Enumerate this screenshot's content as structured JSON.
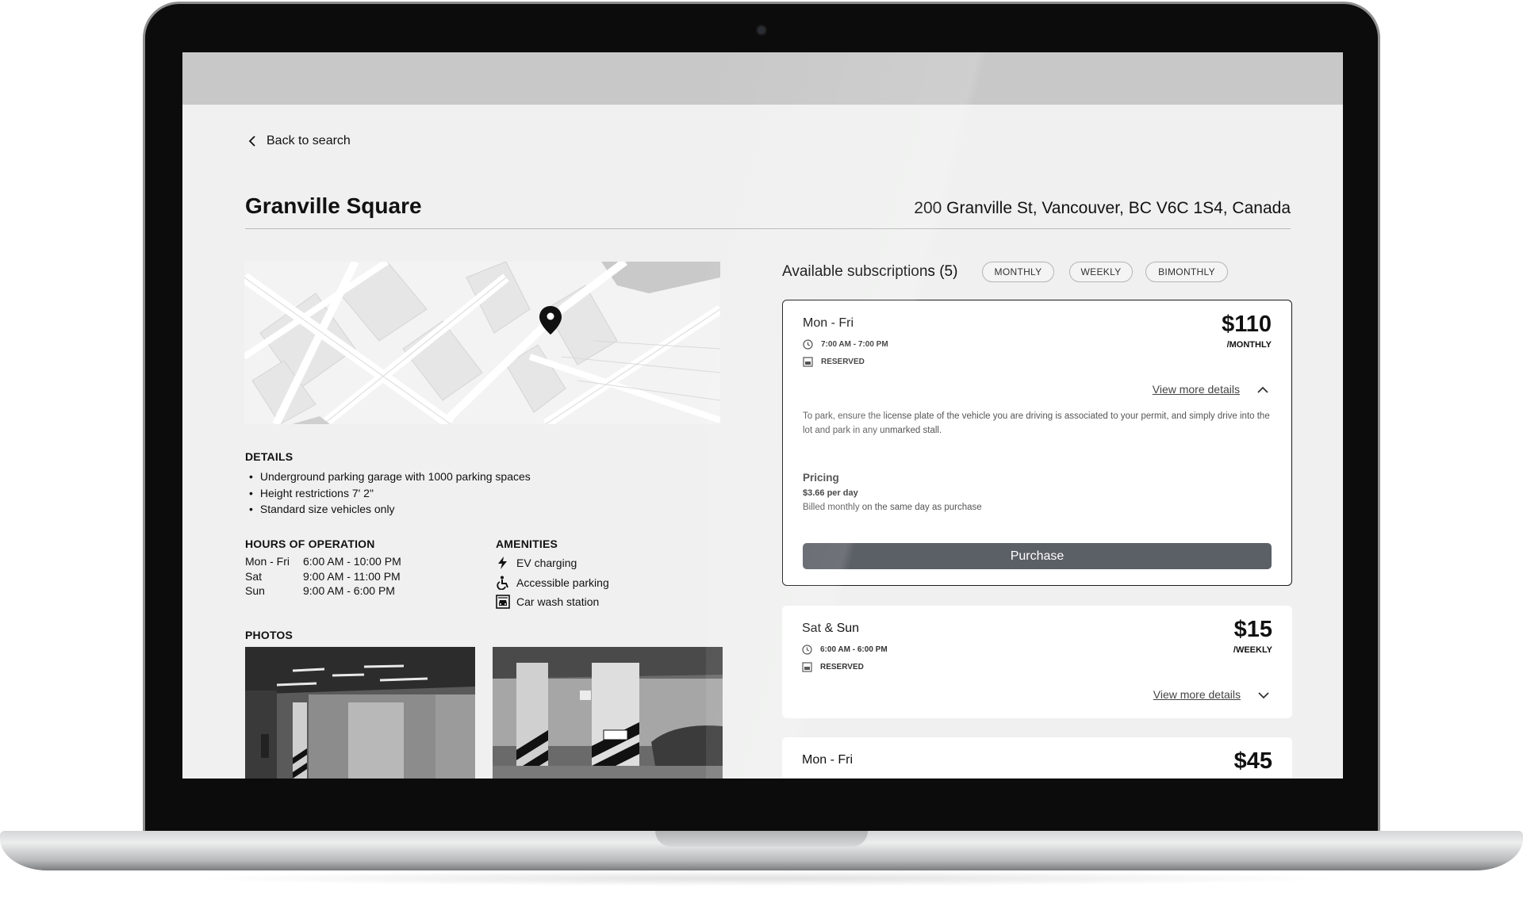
{
  "nav": {
    "back_label": "Back to search"
  },
  "location": {
    "name": "Granville Square",
    "address": "200 Granville St, Vancouver, BC V6C 1S4, Canada"
  },
  "map": {
    "pin_icon": "map-pin-icon"
  },
  "details": {
    "heading": "DETAILS",
    "items": [
      "Underground parking garage with 1000 parking spaces",
      "Height restrictions 7' 2\"",
      "Standard size vehicles only"
    ]
  },
  "hours": {
    "heading": "HOURS OF OPERATION",
    "rows": [
      {
        "day": "Mon - Fri",
        "time": "6:00 AM - 10:00 PM"
      },
      {
        "day": "Sat",
        "time": "9:00 AM - 11:00 PM"
      },
      {
        "day": "Sun",
        "time": "9:00 AM - 6:00 PM"
      }
    ]
  },
  "amenities": {
    "heading": "AMENITIES",
    "items": [
      {
        "icon": "lightning-icon",
        "label": "EV charging"
      },
      {
        "icon": "wheelchair-icon",
        "label": "Accessible parking"
      },
      {
        "icon": "car-wash-icon",
        "label": "Car wash station"
      }
    ]
  },
  "photos": {
    "heading": "PHOTOS"
  },
  "subscriptions": {
    "title": "Available subscriptions (5)",
    "filters": [
      "MONTHLY",
      "WEEKLY",
      "BIMONTHLY"
    ],
    "cards": [
      {
        "days": "Mon - Fri",
        "hours": "7:00 AM - 7:00 PM",
        "type": "RESERVED",
        "price": "$110",
        "period": "/MONTHLY",
        "more_label": "View more details",
        "description": "To park, ensure the license plate of the vehicle you are driving is associated to your permit, and simply drive into the lot and park in any unmarked stall.",
        "pricing_heading": "Pricing",
        "per_day": "$3.66 per day",
        "billing": "Billed monthly on the same day as purchase",
        "cta": "Purchase"
      },
      {
        "days": "Sat & Sun",
        "hours": "6:00 AM - 6:00 PM",
        "type": "RESERVED",
        "price": "$15",
        "period": "/WEEKLY",
        "more_label": "View more details"
      },
      {
        "days": "Mon - Fri",
        "price": "$45"
      }
    ]
  },
  "colors": {
    "page_bg": "#eff0ef",
    "browser_bar": "#c8c8c8",
    "card_bg": "#ffffff",
    "button_bg": "#5b5f66",
    "text": "#111111"
  }
}
